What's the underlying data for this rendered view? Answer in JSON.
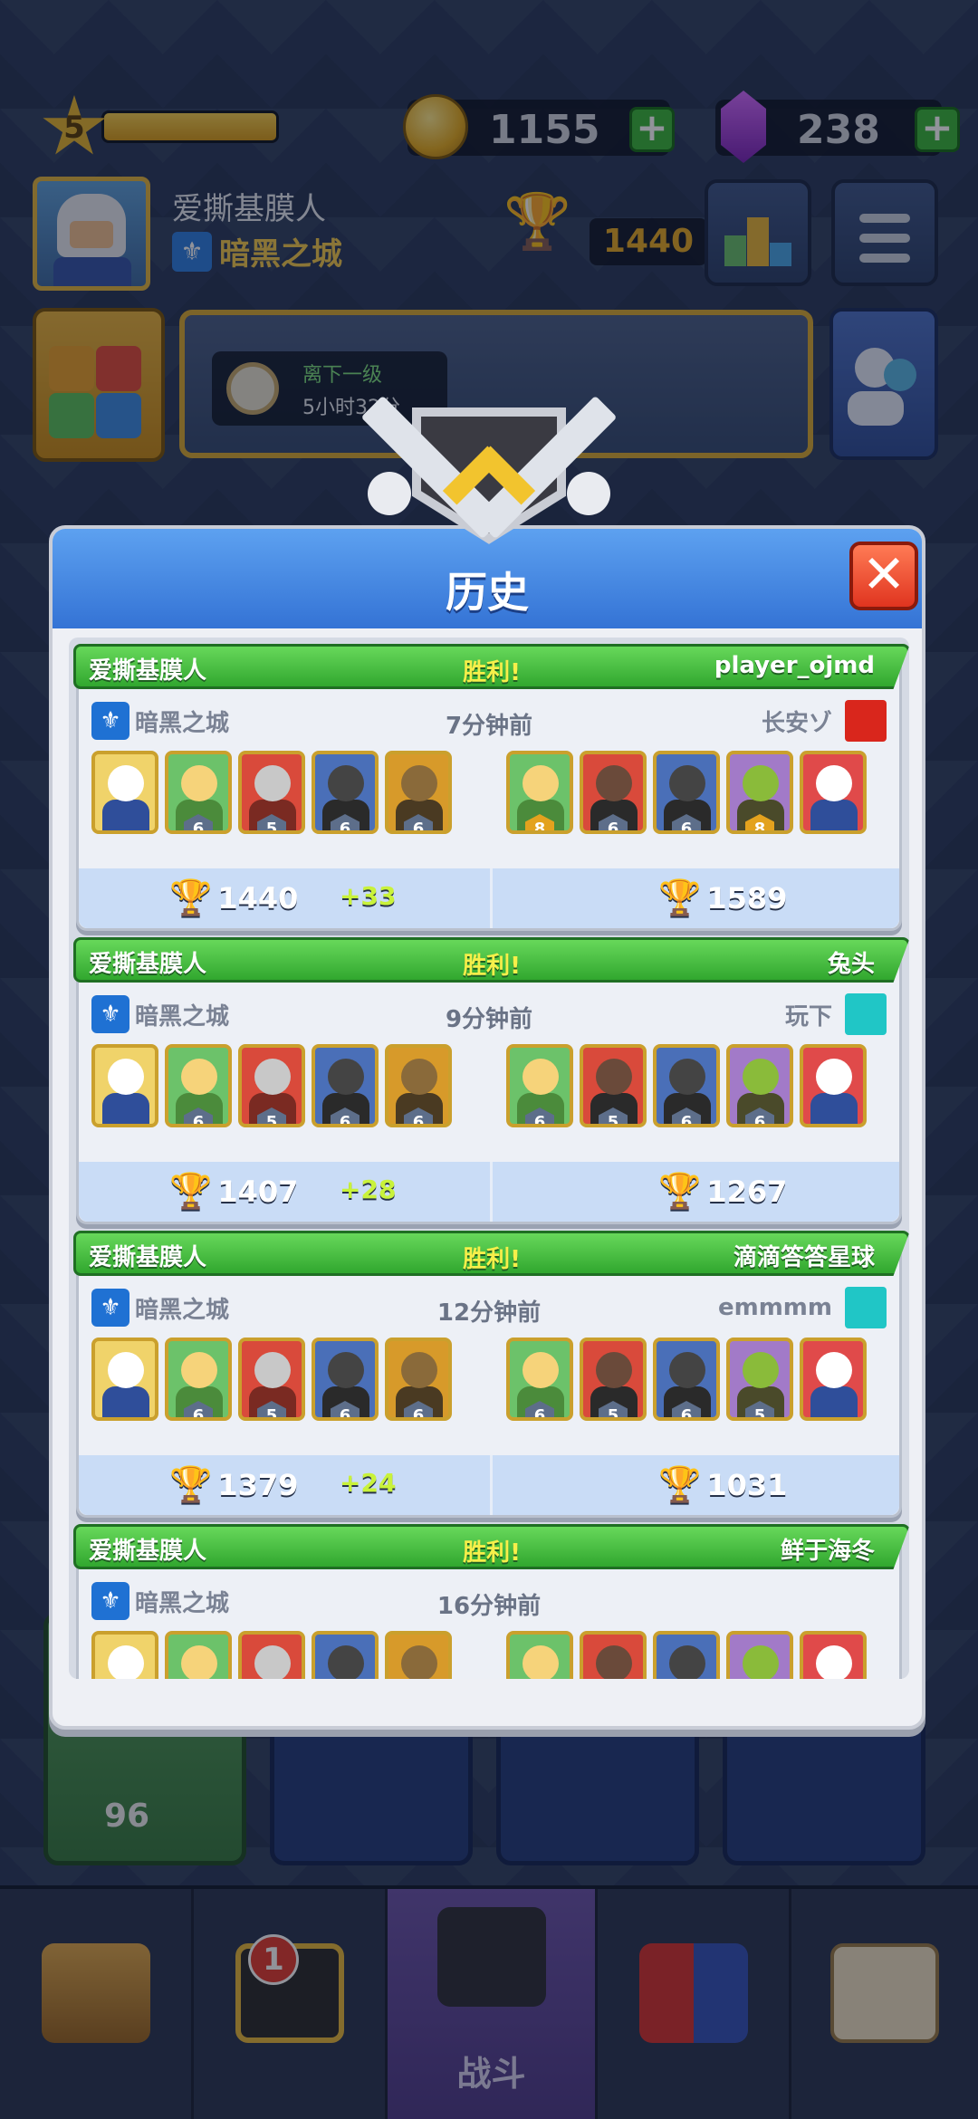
{
  "topbar": {
    "level": "5",
    "level_progress": 1.0,
    "gold": "1155",
    "gems": "238",
    "plus": "+"
  },
  "profile": {
    "name": "爱撕基膜人",
    "clan": "暗黑之城",
    "trophies": "1440"
  },
  "event": {
    "line1": "离下一级",
    "line2": "5小时32分"
  },
  "dialog": {
    "title": "历史",
    "close": "✕"
  },
  "matches": [
    {
      "left": "爱撕基膜人",
      "result": "胜利!",
      "right": "player_ojmd",
      "left_clan": "暗黑之城",
      "time": "7分钟前",
      "right_clan": "长安ゾ",
      "left_levels": [
        "6",
        "5",
        "6",
        "6"
      ],
      "right_levels": [
        "8",
        "6",
        "6",
        "8"
      ],
      "left_trophies": "1440",
      "delta": "+33",
      "right_trophies": "1589",
      "right_flag_color": "#d9261c"
    },
    {
      "left": "爱撕基膜人",
      "result": "胜利!",
      "right": "兔头",
      "left_clan": "暗黑之城",
      "time": "9分钟前",
      "right_clan": "玩下",
      "left_levels": [
        "6",
        "5",
        "6",
        "6"
      ],
      "right_levels": [
        "6",
        "5",
        "6",
        "6"
      ],
      "left_trophies": "1407",
      "delta": "+28",
      "right_trophies": "1267",
      "right_flag_color": "#20c6c6"
    },
    {
      "left": "爱撕基膜人",
      "result": "胜利!",
      "right": "滴滴答答星球",
      "left_clan": "暗黑之城",
      "time": "12分钟前",
      "right_clan": "emmmm",
      "left_levels": [
        "6",
        "5",
        "6",
        "6"
      ],
      "right_levels": [
        "6",
        "5",
        "6",
        "5"
      ],
      "left_trophies": "1379",
      "delta": "+24",
      "right_trophies": "1031",
      "right_flag_color": "#20c6c6"
    },
    {
      "left": "爱撕基膜人",
      "result": "胜利!",
      "right": "鲜于海冬",
      "left_clan": "暗黑之城",
      "time": "16分钟前",
      "right_clan": "",
      "left_levels": [],
      "right_levels": [],
      "left_trophies": "",
      "delta": "",
      "right_trophies": "",
      "right_flag_color": ""
    }
  ],
  "chest": {
    "gem_cost": "96"
  },
  "nav": {
    "cards_badge": "1",
    "battle_label": "战斗"
  },
  "colors": {
    "accent_blue": "#3473d5",
    "win_green": "#31a72f",
    "gold": "#e5a21a"
  }
}
